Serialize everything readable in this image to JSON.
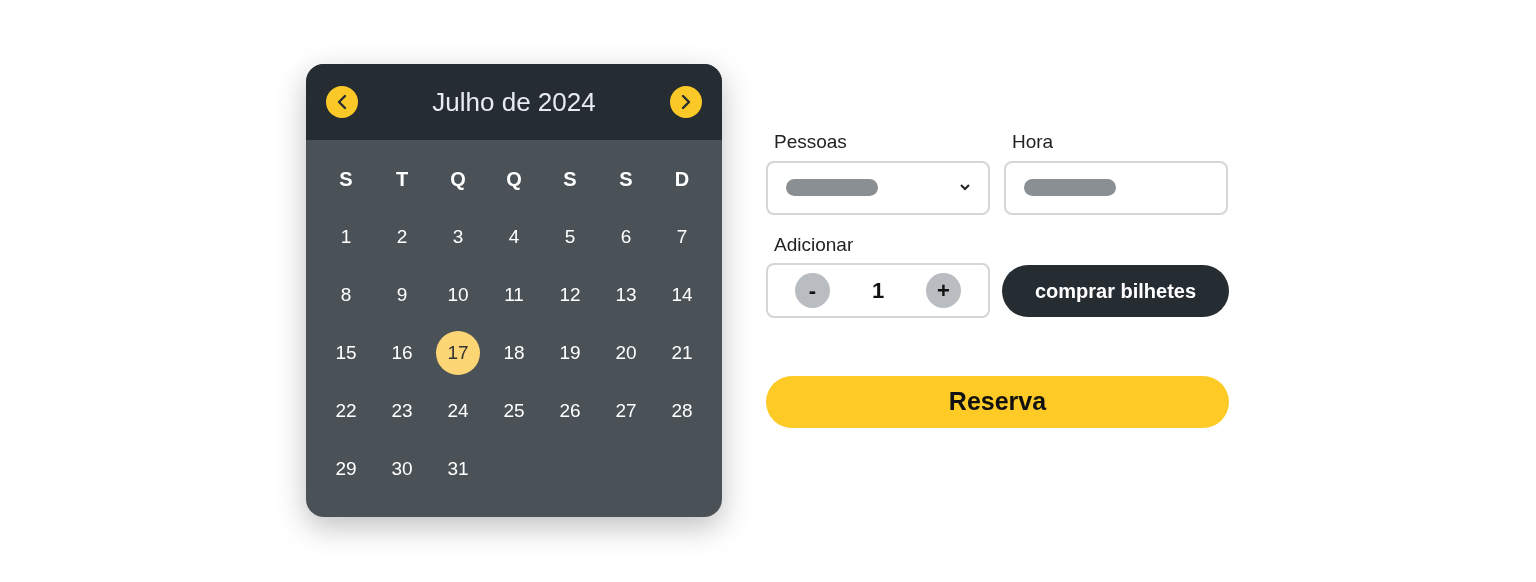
{
  "calendar": {
    "title": "Julho de 2024",
    "weekdays": [
      "S",
      "T",
      "Q",
      "Q",
      "S",
      "S",
      "D"
    ],
    "days": [
      {
        "label": "1",
        "selected": false
      },
      {
        "label": "2",
        "selected": false
      },
      {
        "label": "3",
        "selected": false
      },
      {
        "label": "4",
        "selected": false
      },
      {
        "label": "5",
        "selected": false
      },
      {
        "label": "6",
        "selected": false
      },
      {
        "label": "7",
        "selected": false
      },
      {
        "label": "8",
        "selected": false
      },
      {
        "label": "9",
        "selected": false
      },
      {
        "label": "10",
        "selected": false
      },
      {
        "label": "11",
        "selected": false
      },
      {
        "label": "12",
        "selected": false
      },
      {
        "label": "13",
        "selected": false
      },
      {
        "label": "14",
        "selected": false
      },
      {
        "label": "15",
        "selected": false
      },
      {
        "label": "16",
        "selected": false
      },
      {
        "label": "17",
        "selected": true
      },
      {
        "label": "18",
        "selected": false
      },
      {
        "label": "19",
        "selected": false
      },
      {
        "label": "20",
        "selected": false
      },
      {
        "label": "21",
        "selected": false
      },
      {
        "label": "22",
        "selected": false
      },
      {
        "label": "23",
        "selected": false
      },
      {
        "label": "24",
        "selected": false
      },
      {
        "label": "25",
        "selected": false
      },
      {
        "label": "26",
        "selected": false
      },
      {
        "label": "27",
        "selected": false
      },
      {
        "label": "28",
        "selected": false
      },
      {
        "label": "29",
        "selected": false
      },
      {
        "label": "30",
        "selected": false
      },
      {
        "label": "31",
        "selected": false
      }
    ]
  },
  "form": {
    "people_label": "Pessoas",
    "time_label": "Hora",
    "add_label": "Adicionar",
    "stepper": {
      "minus": "-",
      "value": "1",
      "plus": "+"
    },
    "buy_button": "comprar bilhetes",
    "reserve_button": "Reserva"
  }
}
